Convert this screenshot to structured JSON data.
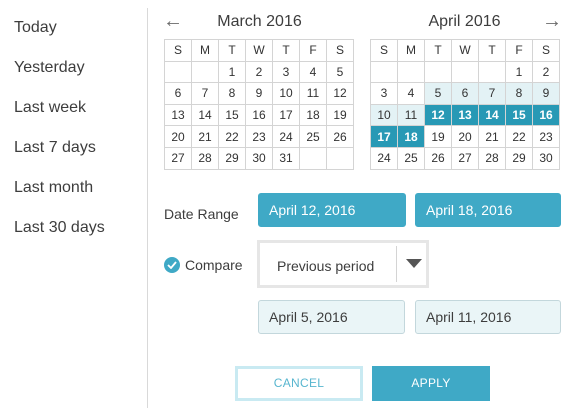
{
  "presets": [
    "Today",
    "Yesterday",
    "Last week",
    "Last 7 days",
    "Last month",
    "Last 30 days"
  ],
  "calendars": [
    {
      "title": "March 2016",
      "weekdays": [
        "S",
        "M",
        "T",
        "W",
        "T",
        "F",
        "S"
      ],
      "weeks": [
        [
          "",
          "",
          "1",
          "2",
          "3",
          "4",
          "5"
        ],
        [
          "6",
          "7",
          "8",
          "9",
          "10",
          "11",
          "12"
        ],
        [
          "13",
          "14",
          "15",
          "16",
          "17",
          "18",
          "19"
        ],
        [
          "20",
          "21",
          "22",
          "23",
          "24",
          "25",
          "26"
        ],
        [
          "27",
          "28",
          "29",
          "30",
          "31",
          "",
          ""
        ]
      ]
    },
    {
      "title": "April 2016",
      "weekdays": [
        "S",
        "M",
        "T",
        "W",
        "T",
        "F",
        "S"
      ],
      "weeks": [
        [
          "",
          "",
          "",
          "",
          "",
          "1",
          "2"
        ],
        [
          "3",
          "4",
          "5",
          "6",
          "7",
          "8",
          "9"
        ],
        [
          "10",
          "11",
          "12",
          "13",
          "14",
          "15",
          "16"
        ],
        [
          "17",
          "18",
          "19",
          "20",
          "21",
          "22",
          "23"
        ],
        [
          "24",
          "25",
          "26",
          "27",
          "28",
          "29",
          "30"
        ]
      ],
      "selected_days": [
        "12",
        "13",
        "14",
        "15",
        "16",
        "17",
        "18"
      ],
      "compare_days": [
        "5",
        "6",
        "7",
        "8",
        "9",
        "10",
        "11"
      ]
    }
  ],
  "nav": {
    "prev_icon": "arrow-left-icon",
    "next_icon": "arrow-right-icon",
    "prev_glyph": "←",
    "next_glyph": "→"
  },
  "date_range": {
    "label": "Date Range",
    "start": "April 12, 2016",
    "end": "April 18, 2016"
  },
  "compare": {
    "label": "Compare",
    "checked": true,
    "option": "Previous period",
    "start": "April 5, 2016",
    "end": "April 11, 2016"
  },
  "buttons": {
    "cancel": "CANCEL",
    "apply": "APPLY"
  },
  "colors": {
    "accent": "#3fa9c6",
    "selected": "#2899b5",
    "compare_fill": "#e3f2f5",
    "field_fill": "#eaf5f7"
  }
}
